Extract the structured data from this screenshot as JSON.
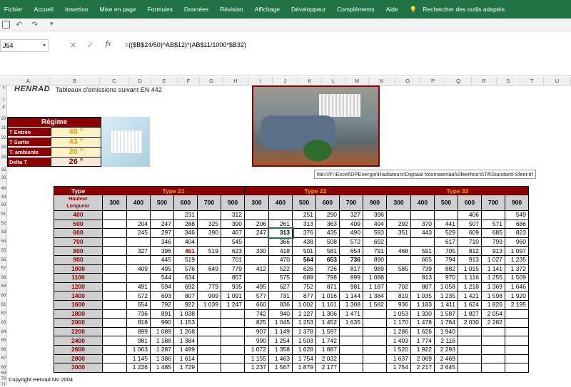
{
  "ribbon": {
    "tabs": [
      "Fichier",
      "Accueil",
      "Insertion",
      "Mise en page",
      "Formules",
      "Données",
      "Révision",
      "Affichage",
      "Développeur",
      "Compléments",
      "Aide",
      "Rechercher des outils adaptés"
    ]
  },
  "namebox": "J54",
  "formula": "=(($B$24/50)^AB$12)*(AB$11/1000*$B32)",
  "columns": [
    "A",
    "B",
    "C",
    "D",
    "E",
    "F",
    "G",
    "H",
    "I",
    "J",
    "K",
    "L",
    "M",
    "N",
    "O",
    "P",
    "Q",
    "R",
    "S",
    "T",
    "U"
  ],
  "rows": [
    "4",
    "7",
    "8",
    "20",
    "21",
    "22",
    "23",
    "24",
    "25",
    "26",
    "48",
    "49",
    "50",
    "51",
    "52",
    "53",
    "54",
    "55",
    "56",
    "57",
    "58",
    "59",
    "60",
    "61",
    "62",
    "63",
    "64",
    "65",
    "66",
    "67",
    "68",
    "69",
    "70",
    "71"
  ],
  "header": {
    "brand": "HENRAD",
    "title": "Tableaux d'émissions suivant EN 442"
  },
  "regime": {
    "title": "Régime",
    "rows": [
      {
        "label": "T Entrée",
        "value": "48 °"
      },
      {
        "label": "T Sortie",
        "value": "43 °"
      },
      {
        "label": "T. ambiante",
        "value": "20 °"
      },
      {
        "label": "Delta T",
        "value": "26 °"
      }
    ]
  },
  "tooltip": "file:///F:\\Excel\\DPEnergie\\Radiateurs\\Digitaal fotomateriaal\\Sfeerfoto's\\Tif\\Standard-Sfeer.tif",
  "table": {
    "type_label": "Type",
    "hauteur_label": "Hauteur",
    "longueur_label": "Longueur",
    "groups": [
      "Type 21",
      "Type 22",
      "Type 33"
    ],
    "heights": [
      "300",
      "400",
      "500",
      "600",
      "700",
      "900"
    ],
    "rows": [
      {
        "len": "400",
        "t21": [
          "",
          "",
          "",
          "231",
          "",
          "312"
        ],
        "t22": [
          "",
          "",
          "251",
          "290",
          "327",
          "396"
        ],
        "t33": [
          "",
          "",
          "",
          "406",
          "",
          "549"
        ]
      },
      {
        "len": "500",
        "t21": [
          "",
          "204",
          "247",
          "288",
          "325",
          "390"
        ],
        "t22": [
          "206",
          "261",
          "313",
          "363",
          "409",
          "494"
        ],
        "t33": [
          "292",
          "370",
          "441",
          "507",
          "571",
          "686"
        ]
      },
      {
        "len": "600",
        "t21": [
          "",
          "245",
          "297",
          "346",
          "390",
          "467"
        ],
        "t22": [
          "247",
          "313",
          "376",
          "435",
          "490",
          "593"
        ],
        "t33": [
          "351",
          "443",
          "529",
          "609",
          "685",
          "823"
        ]
      },
      {
        "len": "700",
        "t21": [
          "",
          "",
          "346",
          "404",
          "",
          "545"
        ],
        "t22": [
          "",
          "366",
          "438",
          "508",
          "572",
          "692"
        ],
        "t33": [
          "",
          "",
          "617",
          "710",
          "799",
          "960"
        ]
      },
      {
        "len": "800",
        "t21": [
          "",
          "327",
          "396",
          "461",
          "519",
          "623"
        ],
        "t22": [
          "330",
          "418",
          "501",
          "581",
          "654",
          "791"
        ],
        "t33": [
          "468",
          "591",
          "705",
          "812",
          "913",
          "1 097"
        ]
      },
      {
        "len": "900",
        "t21": [
          "",
          "",
          "445",
          "519",
          "",
          "701"
        ],
        "t22": [
          "",
          "470",
          "564",
          "653",
          "736",
          "890"
        ],
        "t33": [
          "",
          "665",
          "794",
          "913",
          "1 027",
          "1 235"
        ]
      },
      {
        "len": "1000",
        "t21": [
          "",
          "409",
          "495",
          "576",
          "649",
          "779"
        ],
        "t22": [
          "412",
          "522",
          "626",
          "726",
          "817",
          "989"
        ],
        "t33": [
          "585",
          "739",
          "882",
          "1 015",
          "1 141",
          "1 372"
        ]
      },
      {
        "len": "1100",
        "t21": [
          "",
          "",
          "544",
          "634",
          "",
          "857"
        ],
        "t22": [
          "",
          "575",
          "689",
          "798",
          "899",
          "1 088"
        ],
        "t33": [
          "",
          "813",
          "970",
          "1 116",
          "1 255",
          "1 509"
        ]
      },
      {
        "len": "1200",
        "t21": [
          "",
          "491",
          "594",
          "692",
          "779",
          "935"
        ],
        "t22": [
          "495",
          "627",
          "752",
          "871",
          "981",
          "1 187"
        ],
        "t33": [
          "702",
          "887",
          "1 058",
          "1 218",
          "1 369",
          "1 646"
        ]
      },
      {
        "len": "1400",
        "t21": [
          "",
          "572",
          "693",
          "807",
          "909",
          "1 091"
        ],
        "t22": [
          "577",
          "731",
          "877",
          "1 016",
          "1 144",
          "1 384"
        ],
        "t33": [
          "819",
          "1 035",
          "1 235",
          "1 421",
          "1 598",
          "1 920"
        ]
      },
      {
        "len": "1600",
        "t21": [
          "",
          "654",
          "792",
          "922",
          "1 039",
          "1 247"
        ],
        "t22": [
          "660",
          "836",
          "1 002",
          "1 161",
          "1 308",
          "1 582"
        ],
        "t33": [
          "936",
          "1 183",
          "1 411",
          "1 624",
          "1 826",
          "2 195"
        ]
      },
      {
        "len": "1800",
        "t21": [
          "",
          "736",
          "891",
          "1 038",
          "",
          ""
        ],
        "t22": [
          "742",
          "940",
          "1 127",
          "1 306",
          "1 471",
          ""
        ],
        "t33": [
          "1 053",
          "1 330",
          "1 587",
          "1 827",
          "2 054",
          ""
        ]
      },
      {
        "len": "2000",
        "t21": [
          "",
          "818",
          "990",
          "1 153",
          "",
          ""
        ],
        "t22": [
          "825",
          "1 045",
          "1 253",
          "1 452",
          "1 635",
          ""
        ],
        "t33": [
          "1 170",
          "1 478",
          "1 764",
          "2 030",
          "2 282",
          ""
        ]
      },
      {
        "len": "2200",
        "t21": [
          "",
          "899",
          "1 089",
          "1 268",
          "",
          ""
        ],
        "t22": [
          "907",
          "1 149",
          "1 378",
          "1 597",
          "",
          ""
        ],
        "t33": [
          "1 286",
          "1 626",
          "1 940",
          "",
          "",
          ""
        ]
      },
      {
        "len": "2400",
        "t21": [
          "",
          "981",
          "1 188",
          "1 384",
          "",
          ""
        ],
        "t22": [
          "990",
          "1 254",
          "1 503",
          "1 742",
          "",
          ""
        ],
        "t33": [
          "1 403",
          "1 774",
          "2 116",
          "",
          "",
          ""
        ]
      },
      {
        "len": "2600",
        "t21": [
          "",
          "1 063",
          "1 287",
          "1 499",
          "",
          ""
        ],
        "t22": [
          "1 072",
          "1 358",
          "1 628",
          "1 887",
          "",
          ""
        ],
        "t33": [
          "1 520",
          "1 922",
          "2 293",
          "",
          "",
          ""
        ]
      },
      {
        "len": "2800",
        "t21": [
          "",
          "1 145",
          "1 386",
          "1 614",
          "",
          ""
        ],
        "t22": [
          "1 155",
          "1 463",
          "1 754",
          "2 032",
          "",
          ""
        ],
        "t33": [
          "1 637",
          "2 069",
          "2 469",
          "",
          "",
          ""
        ]
      },
      {
        "len": "3000",
        "t21": [
          "",
          "1 226",
          "1 485",
          "1 729",
          "",
          ""
        ],
        "t22": [
          "1 237",
          "1 567",
          "1 879",
          "2 177",
          "",
          ""
        ],
        "t33": [
          "1 754",
          "2 217",
          "2 645",
          "",
          "",
          ""
        ]
      }
    ]
  },
  "footer": "Copyright Henrad NV 2004"
}
